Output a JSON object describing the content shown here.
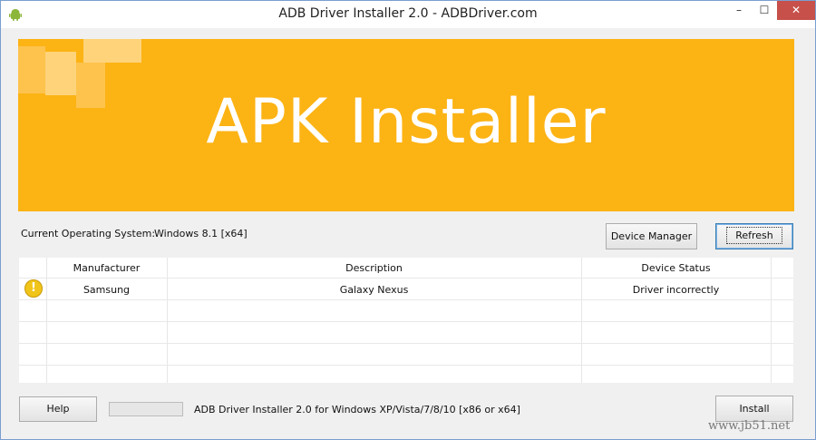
{
  "window": {
    "title": "ADB Driver Installer 2.0 - ADBDriver.com",
    "min_glyph": "–",
    "max_glyph": "☐",
    "close_glyph": "✕"
  },
  "banner": {
    "title": "APK Installer",
    "color": "#fcb314"
  },
  "system": {
    "label": "Current Operating System:",
    "value": "Windows 8.1  [x64]"
  },
  "buttons": {
    "device_manager": "Device Manager",
    "refresh": "Refresh",
    "help": "Help",
    "install": "Install"
  },
  "table": {
    "headers": {
      "manufacturer": "Manufacturer",
      "description": "Description",
      "status": "Device Status"
    },
    "rows": [
      {
        "icon": "warning-icon",
        "icon_glyph": "!",
        "manufacturer": "Samsung",
        "description": "Galaxy Nexus",
        "status": "Driver incorrectly"
      }
    ]
  },
  "status_bar": {
    "text": "ADB Driver Installer 2.0 for Windows XP/Vista/7/8/10 [x86 or x64]",
    "progress": 0
  },
  "watermark": "www.jb51.net"
}
